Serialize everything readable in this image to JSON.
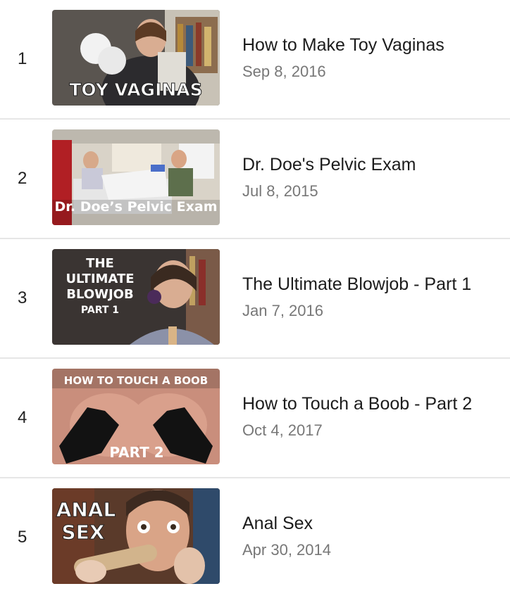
{
  "videos": [
    {
      "rank": "1",
      "title": "How to Make Toy Vaginas",
      "date": "Sep 8, 2016",
      "thumb_text": "TOY VAGINAS"
    },
    {
      "rank": "2",
      "title": "Dr. Doe's Pelvic Exam",
      "date": "Jul 8, 2015",
      "thumb_text": "Dr. Doe’s Pelvic Exam"
    },
    {
      "rank": "3",
      "title": "The Ultimate Blowjob - Part 1",
      "date": "Jan 7, 2016",
      "thumb_lines": [
        "THE",
        "ULTIMATE",
        "BLOWJOB",
        "PART 1"
      ]
    },
    {
      "rank": "4",
      "title": "How to Touch a Boob - Part 2",
      "date": "Oct 4, 2017",
      "thumb_top": "HOW TO TOUCH A BOOB",
      "thumb_bottom": "PART 2"
    },
    {
      "rank": "5",
      "title": "Anal Sex",
      "date": "Apr 30, 2014",
      "thumb_lines": [
        "ANAL",
        "SEX"
      ]
    }
  ]
}
